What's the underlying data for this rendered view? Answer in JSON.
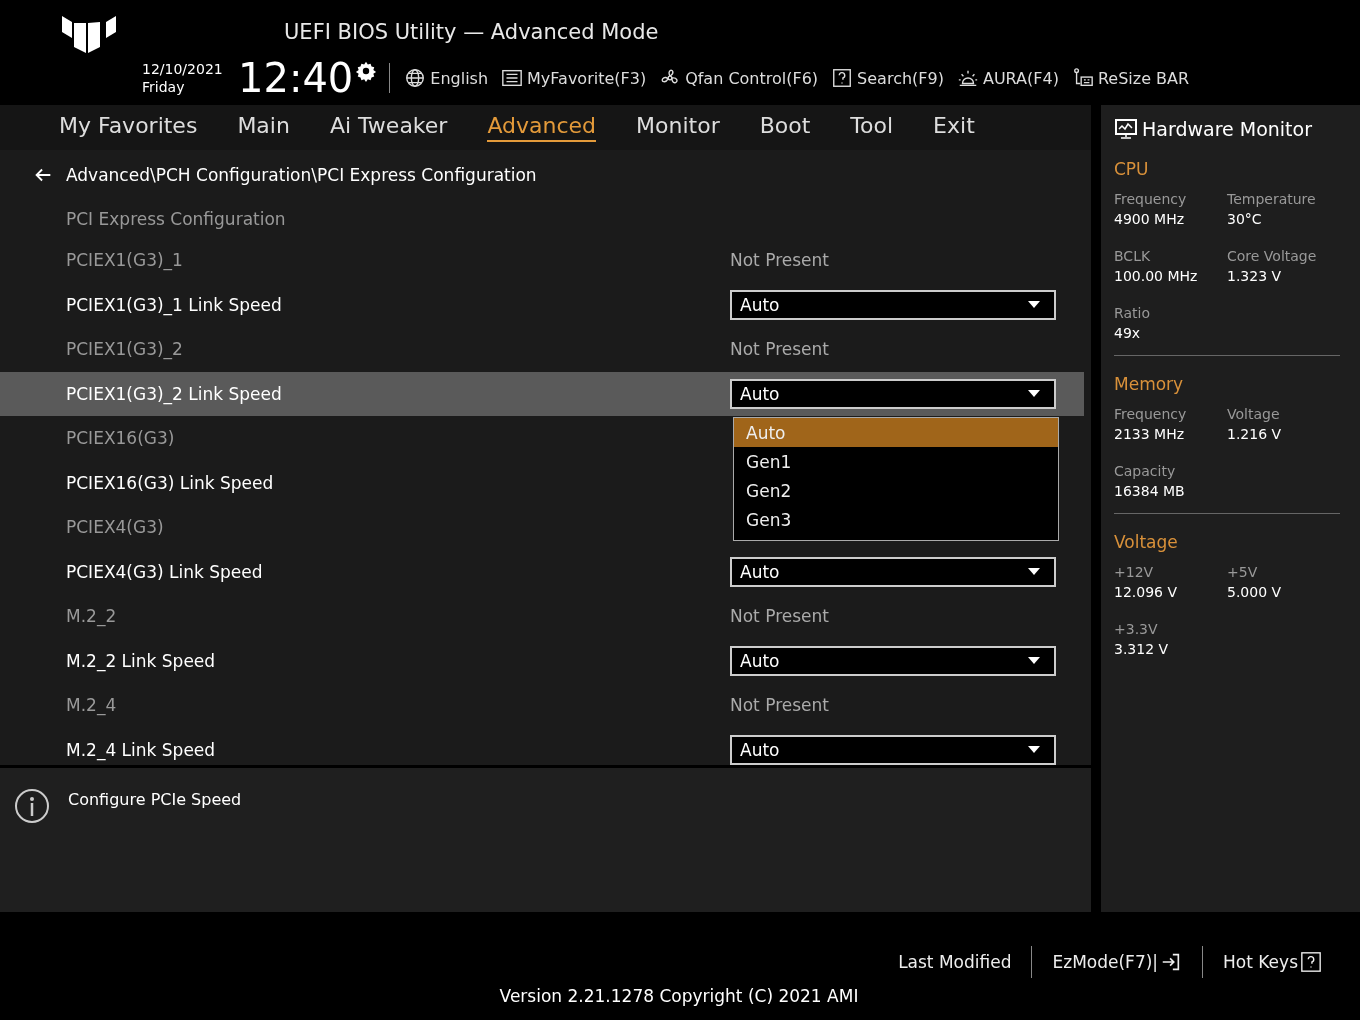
{
  "header": {
    "title": "UEFI BIOS Utility — Advanced Mode",
    "date": "12/10/2021",
    "day": "Friday",
    "time": "12:40",
    "tools": [
      {
        "kind": "globe",
        "label": "English"
      },
      {
        "kind": "list",
        "label": "MyFavorite(F3)"
      },
      {
        "kind": "fan",
        "label": "Qfan Control(F6)"
      },
      {
        "kind": "help",
        "label": "Search(F9)"
      },
      {
        "kind": "aura",
        "label": "AURA(F4)"
      },
      {
        "kind": "bar",
        "label": "ReSize BAR"
      }
    ]
  },
  "tabs": [
    {
      "label": "My Favorites",
      "selected": false
    },
    {
      "label": "Main",
      "selected": false
    },
    {
      "label": "Ai Tweaker",
      "selected": false
    },
    {
      "label": "Advanced",
      "selected": true
    },
    {
      "label": "Monitor",
      "selected": false
    },
    {
      "label": "Boot",
      "selected": false
    },
    {
      "label": "Tool",
      "selected": false
    },
    {
      "label": "Exit",
      "selected": false
    }
  ],
  "settings": {
    "path": "Advanced\\PCH Configuration\\PCI Express Configuration",
    "heading": "PCI Express Configuration",
    "rows": [
      {
        "kind": "status",
        "label": "PCIEX1(G3)_1",
        "value": "Not Present",
        "selected": false
      },
      {
        "kind": "select",
        "label": "PCIEX1(G3)_1 Link Speed",
        "value": "Auto",
        "selected": false
      },
      {
        "kind": "status",
        "label": "PCIEX1(G3)_2",
        "value": "Not Present",
        "selected": false
      },
      {
        "kind": "select",
        "label": "PCIEX1(G3)_2 Link Speed",
        "value": "Auto",
        "selected": true
      },
      {
        "kind": "status",
        "label": "PCIEX16(G3)",
        "selected": false
      },
      {
        "kind": "select",
        "label": "PCIEX16(G3) Link Speed",
        "selected": false
      },
      {
        "kind": "status",
        "label": "PCIEX4(G3)",
        "selected": false
      },
      {
        "kind": "select",
        "label": "PCIEX4(G3) Link Speed",
        "value": "Auto",
        "selected": false
      },
      {
        "kind": "status",
        "label": "M.2_2",
        "value": "Not Present",
        "selected": false
      },
      {
        "kind": "select",
        "label": "M.2_2 Link Speed",
        "value": "Auto",
        "selected": false
      },
      {
        "kind": "status",
        "label": "M.2_4",
        "value": "Not Present",
        "selected": false
      },
      {
        "kind": "select",
        "label": "M.2_4 Link Speed",
        "value": "Auto",
        "selected": false
      }
    ]
  },
  "dropdown": {
    "options": [
      {
        "label": "Auto",
        "selected": true
      },
      {
        "label": "Gen1",
        "selected": false
      },
      {
        "label": "Gen2",
        "selected": false
      },
      {
        "label": "Gen3",
        "selected": false
      }
    ]
  },
  "help": {
    "text": "Configure PCIe Speed"
  },
  "hardware_monitor": {
    "title": "Hardware Monitor",
    "sections": [
      {
        "title": "CPU",
        "items": [
          {
            "label": "Frequency",
            "value": "4900 MHz"
          },
          {
            "label": "Temperature",
            "value": "30°C"
          },
          {
            "label": "BCLK",
            "value": "100.00 MHz"
          },
          {
            "label": "Core Voltage",
            "value": "1.323 V"
          },
          {
            "label": "Ratio",
            "value": "49x"
          }
        ]
      },
      {
        "title": "Memory",
        "items": [
          {
            "label": "Frequency",
            "value": "2133 MHz"
          },
          {
            "label": "Voltage",
            "value": "1.216 V"
          },
          {
            "label": "Capacity",
            "value": "16384 MB"
          }
        ]
      },
      {
        "title": "Voltage",
        "items": [
          {
            "label": "+12V",
            "value": "12.096 V"
          },
          {
            "label": "+5V",
            "value": "5.000 V"
          },
          {
            "label": "+3.3V",
            "value": "3.312 V"
          }
        ]
      }
    ]
  },
  "footer": {
    "buttons": [
      {
        "kind": "plain",
        "label": "Last Modified"
      },
      {
        "kind": "exit",
        "label": "EzMode(F7)|"
      },
      {
        "kind": "help",
        "label": "Hot Keys"
      }
    ],
    "version": "Version 2.21.1278 Copyright (C) 2021 AMI"
  }
}
